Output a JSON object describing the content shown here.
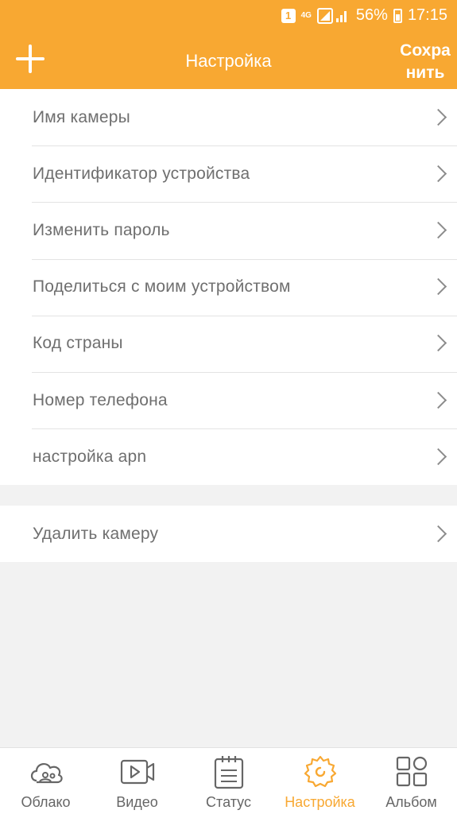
{
  "status_bar": {
    "network": "4G",
    "battery": "56%",
    "time": "17:15",
    "notification": "1"
  },
  "header": {
    "title": "Настройка",
    "save_label": "Сохранить"
  },
  "settings": {
    "items": [
      {
        "label": "Имя камеры"
      },
      {
        "label": "Идентификатор устройства"
      },
      {
        "label": "Изменить пароль"
      },
      {
        "label": "Поделиться с моим устройством"
      },
      {
        "label": "Код страны"
      },
      {
        "label": "Номер телефона"
      },
      {
        "label": "настройка apn"
      }
    ],
    "delete_label": "Удалить камеру"
  },
  "tabbar": {
    "tabs": [
      {
        "label": "Облако",
        "icon": "cloud-icon"
      },
      {
        "label": "Видео",
        "icon": "video-icon"
      },
      {
        "label": "Статус",
        "icon": "notepad-icon"
      },
      {
        "label": "Настройка",
        "icon": "gear-icon",
        "active": true
      },
      {
        "label": "Альбом",
        "icon": "album-grid-icon"
      }
    ]
  },
  "colors": {
    "accent": "#f8a832",
    "text": "#6f6f6f",
    "background": "#f2f2f2"
  }
}
